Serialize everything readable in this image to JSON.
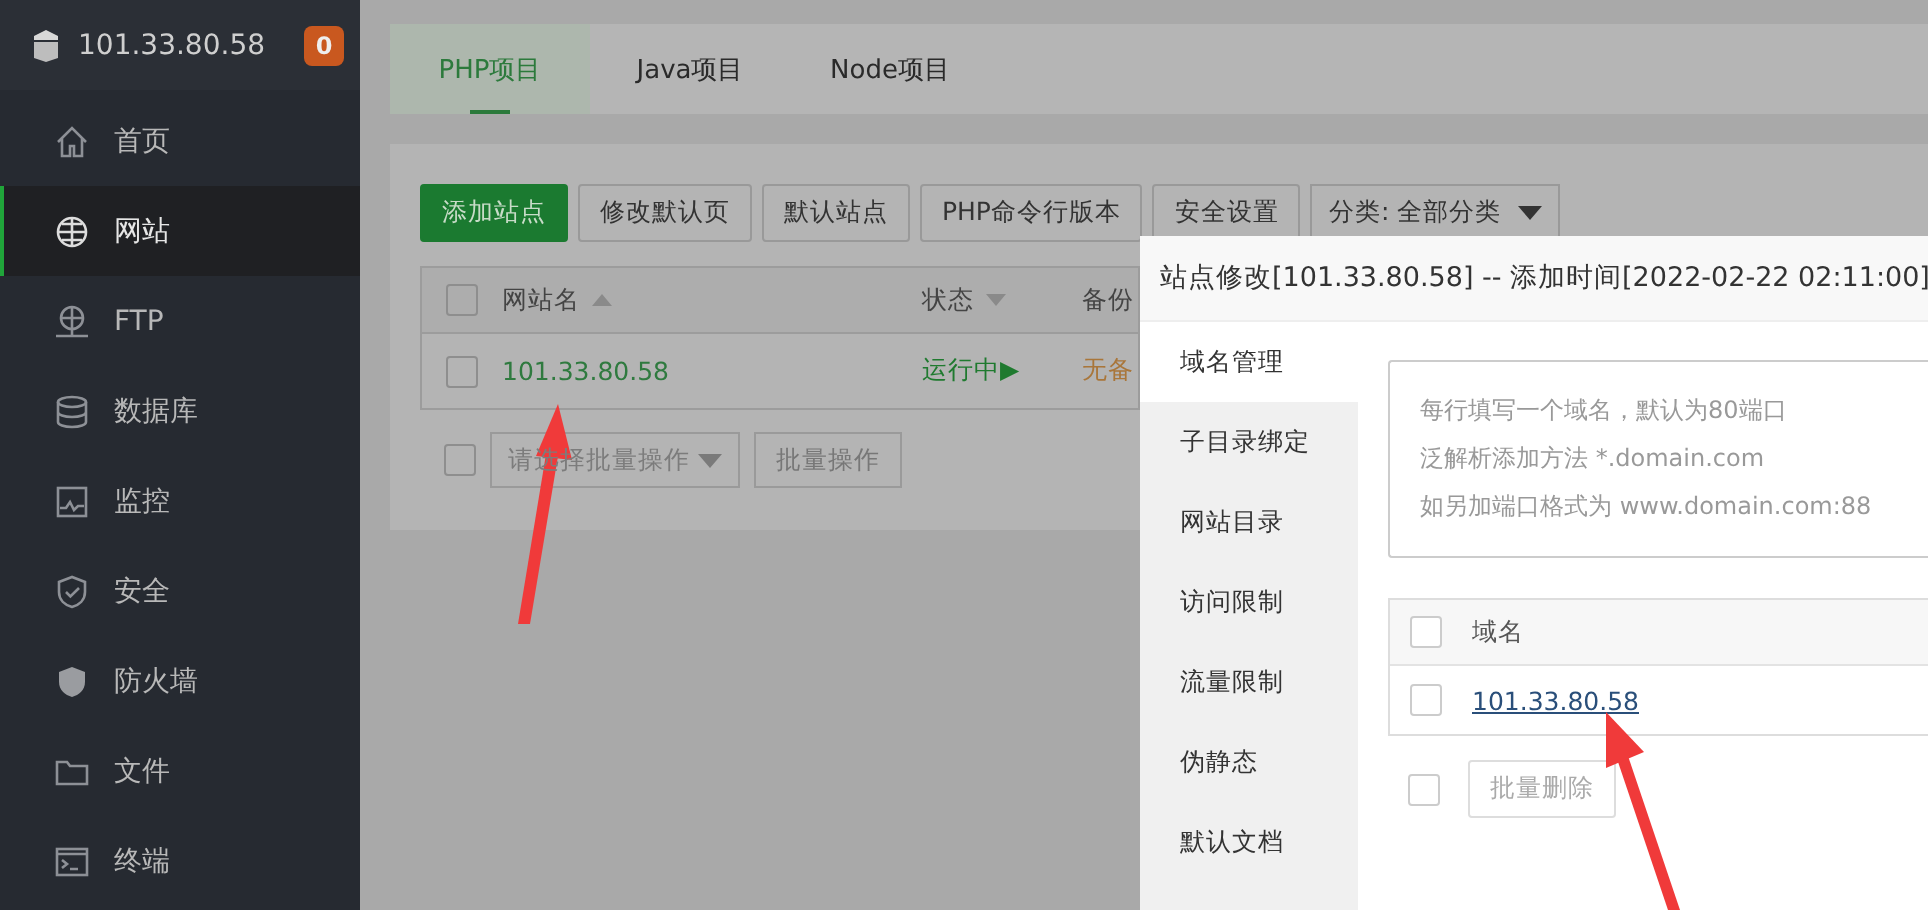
{
  "sidebar": {
    "host": "101.33.80.58",
    "badge": "0",
    "items": [
      {
        "label": "首页",
        "kind": "home",
        "selected": false
      },
      {
        "label": "网站",
        "kind": "globe",
        "selected": true
      },
      {
        "label": "FTP",
        "kind": "ftp",
        "selected": false
      },
      {
        "label": "数据库",
        "kind": "database",
        "selected": false
      },
      {
        "label": "监控",
        "kind": "monitor",
        "selected": false
      },
      {
        "label": "安全",
        "kind": "shield",
        "selected": false
      },
      {
        "label": "防火墙",
        "kind": "firewall",
        "selected": false
      },
      {
        "label": "文件",
        "kind": "folder",
        "selected": false
      },
      {
        "label": "终端",
        "kind": "terminal",
        "selected": false
      }
    ]
  },
  "tabs": [
    {
      "label": "PHP项目",
      "selected": true
    },
    {
      "label": "Java项目",
      "selected": false
    },
    {
      "label": "Node项目",
      "selected": false
    }
  ],
  "toolbar": {
    "buttons": [
      {
        "label": "添加站点",
        "kind": "primary"
      },
      {
        "label": "修改默认页",
        "kind": "default"
      },
      {
        "label": "默认站点",
        "kind": "default"
      },
      {
        "label": "PHP命令行版本",
        "kind": "default"
      },
      {
        "label": "安全设置",
        "kind": "default"
      }
    ],
    "category": "分类: 全部分类"
  },
  "table": {
    "select_all_checked": false,
    "columns": [
      {
        "label": "网站名",
        "kind": "ascending"
      },
      {
        "label": "状态",
        "kind": "descending"
      },
      {
        "label": "备份",
        "kind": "plain"
      }
    ],
    "rows": [
      {
        "checked": false,
        "name": "101.33.80.58",
        "status": "运行中▶",
        "backup": "无备"
      }
    ]
  },
  "batch": {
    "checked": false,
    "placeholder": "请选择批量操作",
    "button": "批量操作"
  },
  "modal": {
    "title": "站点修改[101.33.80.58] -- 添加时间[2022-02-22 02:11:00]",
    "nav": [
      {
        "label": "域名管理",
        "selected": true
      },
      {
        "label": "子目录绑定",
        "selected": false
      },
      {
        "label": "网站目录",
        "selected": false
      },
      {
        "label": "访问限制",
        "selected": false
      },
      {
        "label": "流量限制",
        "selected": false
      },
      {
        "label": "伪静态",
        "selected": false
      },
      {
        "label": "默认文档",
        "selected": false
      }
    ],
    "domain_input": {
      "placeholder": [
        "每行填写一个域名，默认为80端口",
        "泛解析添加方法 *.domain.com",
        "如另加端口格式为 www.domain.com:88"
      ]
    },
    "domain_table": {
      "select_all_checked": false,
      "column": "域名",
      "rows": [
        {
          "checked": false,
          "domain": "101.33.80.58"
        }
      ]
    },
    "delete_checked": false,
    "delete_button": "批量删除"
  }
}
